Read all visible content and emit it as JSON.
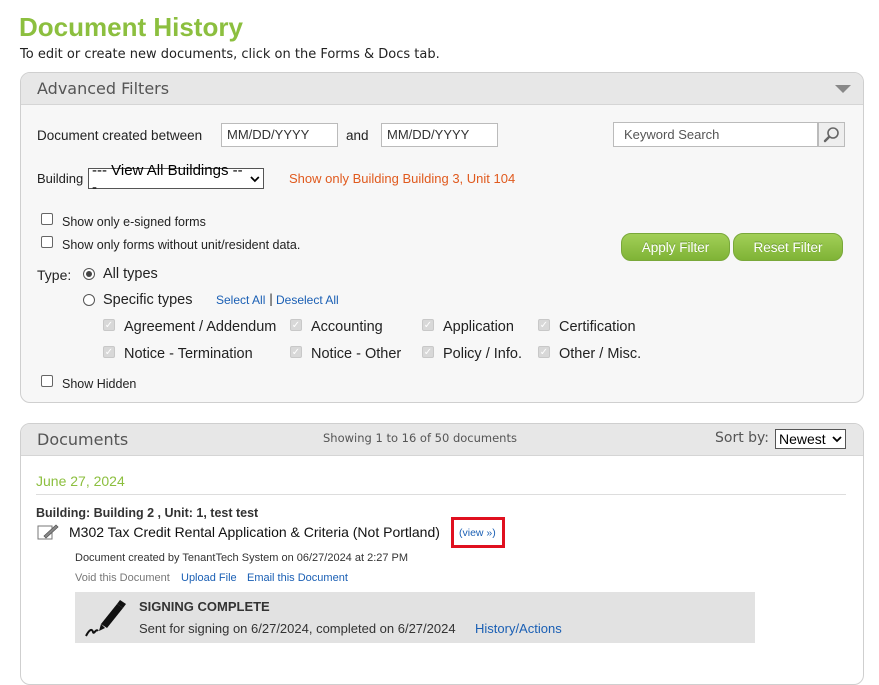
{
  "page": {
    "title": "Document History",
    "subtitle": "To edit or create new documents, click on the Forms & Docs tab."
  },
  "filters": {
    "header": "Advanced Filters",
    "date_label": "Document created between",
    "date_from_placeholder": "MM/DD/YYYY",
    "and_label": "and",
    "date_to_placeholder": "MM/DD/YYYY",
    "keyword_placeholder": "Keyword Search",
    "building_label": "Building",
    "building_selected": "--- View All Buildings ---",
    "show_only_link": "Show only Building Building 3, Unit 104",
    "esigned_label": "Show only e-signed forms",
    "without_unit_label": "Show only forms without unit/resident data.",
    "apply_label": "Apply Filter",
    "reset_label": "Reset Filter",
    "type_label": "Type:",
    "all_types_label": "All types",
    "specific_types_label": "Specific types",
    "select_all": "Select All",
    "separator": "|",
    "deselect_all": "Deselect All",
    "types": [
      "Agreement / Addendum",
      "Accounting",
      "Application",
      "Certification",
      "Notice - Termination",
      "Notice - Other",
      "Policy / Info.",
      "Other / Misc."
    ],
    "show_hidden_label": "Show Hidden"
  },
  "documents": {
    "header": "Documents",
    "showing": "Showing 1 to 16 of 50 documents",
    "sort_label": "Sort by:",
    "sort_selected": "Newest",
    "date_group": "June 27, 2024",
    "item": {
      "building_line": "Building: Building 2 ,  Unit: 1, test test",
      "title": "M302 Tax Credit Rental Application & Criteria (Not Portland)",
      "view_link": "(view »)",
      "created": "Document created by TenantTech System on 06/27/2024 at 2:27 PM",
      "void_action": "Void this Document",
      "upload_action": "Upload File",
      "email_action": "Email this Document",
      "signing_status": "SIGNING COMPLETE",
      "signing_detail": "Sent for signing on 6/27/2024, completed on 6/27/2024",
      "history_link": "History/Actions"
    }
  },
  "colors": {
    "title_green": "#8cbf3f",
    "button_green": "#8cbf45",
    "link_blue": "#1a5fb4",
    "orange_link": "#e05a1e",
    "highlight_red": "#e0101f"
  }
}
